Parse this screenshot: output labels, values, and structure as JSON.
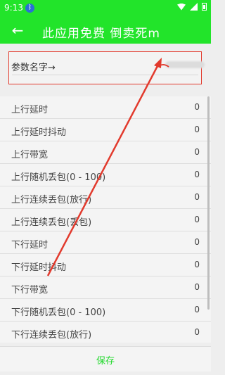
{
  "status_bar": {
    "time": "9:13",
    "bt_badge": "ᛒ",
    "icons": [
      "wifi-icon",
      "signal-icon",
      "battery-icon"
    ]
  },
  "app_bar": {
    "back_icon": "←",
    "title": "此应用免费  倒卖死m",
    "color": "#22e42a"
  },
  "param": {
    "label": "参数名字→",
    "value": ""
  },
  "params_list": [
    {
      "name": "上行延时",
      "value": "0"
    },
    {
      "name": "上行延时抖动",
      "value": "0"
    },
    {
      "name": "上行带宽",
      "value": "0"
    },
    {
      "name": "上行随机丢包(0 - 100)",
      "value": "0"
    },
    {
      "name": "上行连续丢包(放行)",
      "value": "0"
    },
    {
      "name": "上行连续丢包(丢包)",
      "value": "0"
    },
    {
      "name": "下行延时",
      "value": "0"
    },
    {
      "name": "下行延时抖动",
      "value": "0"
    },
    {
      "name": "下行带宽",
      "value": "0"
    },
    {
      "name": "下行随机丢包(0 - 100)",
      "value": "0"
    },
    {
      "name": "下行连续丢包(放行)",
      "value": "0"
    }
  ],
  "save_label": "保存",
  "annotation": {
    "color": "#e23a2d"
  }
}
